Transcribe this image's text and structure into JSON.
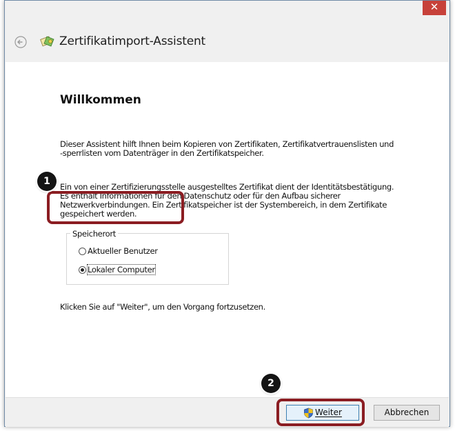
{
  "window": {
    "title": "Zertifikatimport-Assistent",
    "close_symbol": "✕"
  },
  "content": {
    "heading": "Willkommen",
    "paragraph1": [
      "Dieser Assistent hilft Ihnen beim Kopieren von Zertifikaten, Zertifikatvertrauenslisten und",
      "-sperrlisten vom Datenträger in den Zertifikatspeicher."
    ],
    "paragraph2": [
      "Ein von einer Zertifizierungsstelle ausgestelltes Zertifikat dient der Identitätsbestätigung.",
      "Es enthält Informationen für den Datenschutz oder für den Aufbau sicherer",
      "Netzwerkverbindungen. Ein Zertifikatspeicher ist der Systembereich, in dem Zertifikate",
      "gespeichert werden."
    ],
    "location_group": {
      "legend": "Speicherort",
      "options": [
        {
          "label": "Aktueller Benutzer",
          "selected": false
        },
        {
          "label": "Lokaler Computer",
          "selected": true
        }
      ]
    },
    "continue_hint": "Klicken Sie auf \"Weiter\", um den Vorgang fortzusetzen."
  },
  "footer": {
    "next_label": "Weiter",
    "cancel_label": "Abbrechen"
  },
  "annotations": {
    "step1": "1",
    "step2": "2"
  },
  "colors": {
    "highlight": "#8b1d22",
    "close_button": "#c7413a",
    "badge": "#141414"
  }
}
